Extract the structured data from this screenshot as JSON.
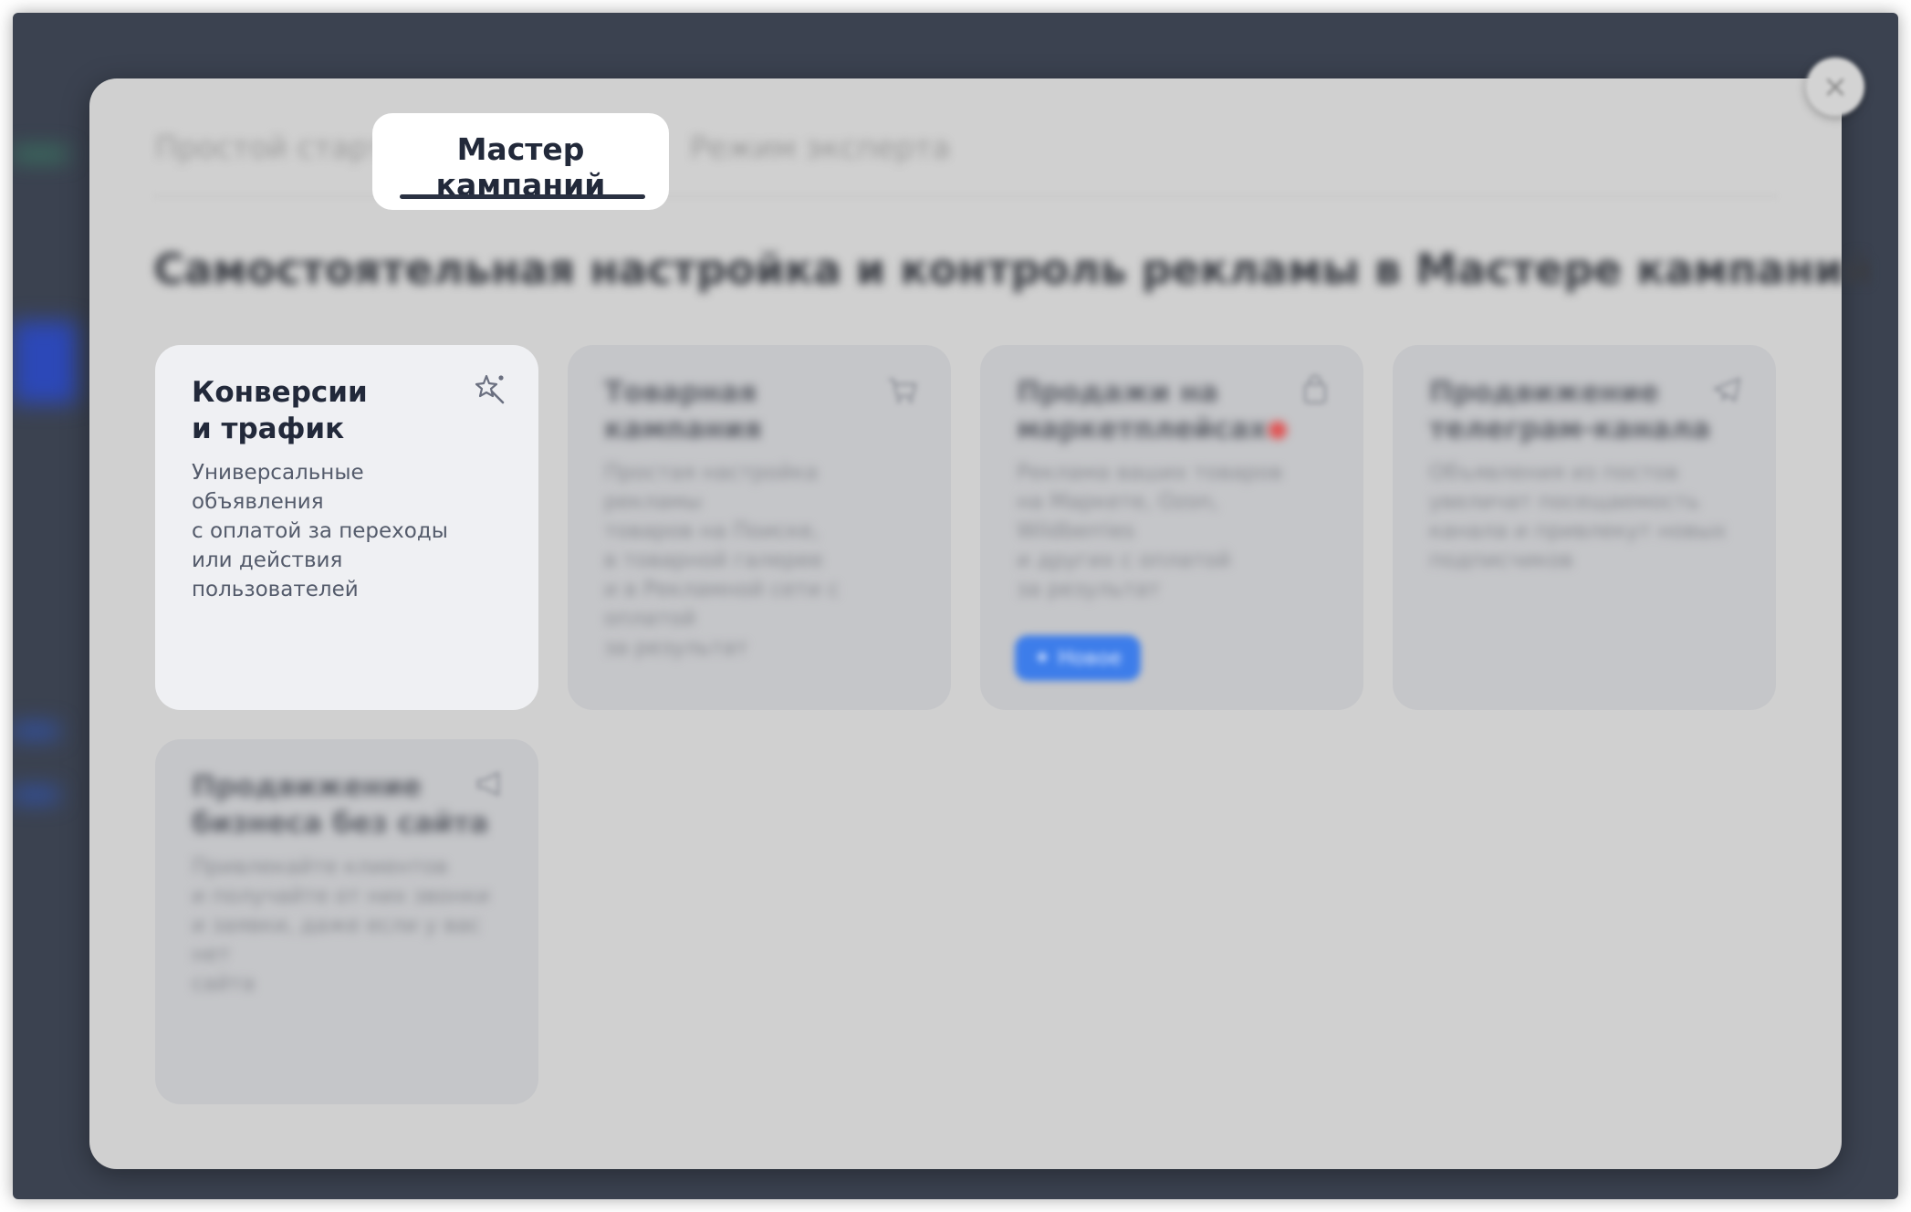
{
  "tabs": [
    {
      "label": "Простой старт",
      "active": false
    },
    {
      "label": "Мастер кампаний",
      "active": true
    },
    {
      "label": "Режим эксперта",
      "active": false
    }
  ],
  "heading": "Самостоятельная настройка и контроль рекламы в Мастере кампаний",
  "cards": [
    {
      "title_line1": "Конверсии",
      "title_line2": "и трафик",
      "desc": [
        "Универсальные объявления",
        "с оплатой за переходы",
        "или действия пользователей"
      ],
      "icon": "magic-wand-icon",
      "active": true
    },
    {
      "title_line1": "Товарная",
      "title_line2": "кампания",
      "desc": [
        "Простая настройка рекламы",
        "товаров на Поиске,",
        "в товарной галерее",
        "и в Рекламной сети с оплатой",
        "за результат"
      ],
      "icon": "cart-icon",
      "active": false
    },
    {
      "title_line1": "Продажи на",
      "title_line2": "маркетплейсах",
      "desc": [
        "Реклама ваших товаров",
        "на Маркете, Ozon, Wildberries",
        "и других с оплатой",
        "за результат"
      ],
      "icon": "shopping-bag-icon",
      "active": false,
      "badge": "Новое"
    },
    {
      "title_line1": "Продвижение",
      "title_line2": "телеграм-канала",
      "desc": [
        "Объявления из постов",
        "увеличат посещаемость",
        "канала и привлекут новых",
        "подписчиков"
      ],
      "icon": "telegram-icon",
      "active": false
    },
    {
      "title_line1": "Продвижение",
      "title_line2": "бизнеса без сайта",
      "desc": [
        "Привлекайте клиентов",
        "и получайте от них звонки",
        "и заявки, даже если у вас нет",
        "сайта"
      ],
      "icon": "megaphone-icon",
      "active": false
    }
  ],
  "close_label": "×",
  "colors": {
    "accent": "#3d7dea",
    "active_text": "#22293a",
    "modal_bg": "#d0d0d0"
  }
}
